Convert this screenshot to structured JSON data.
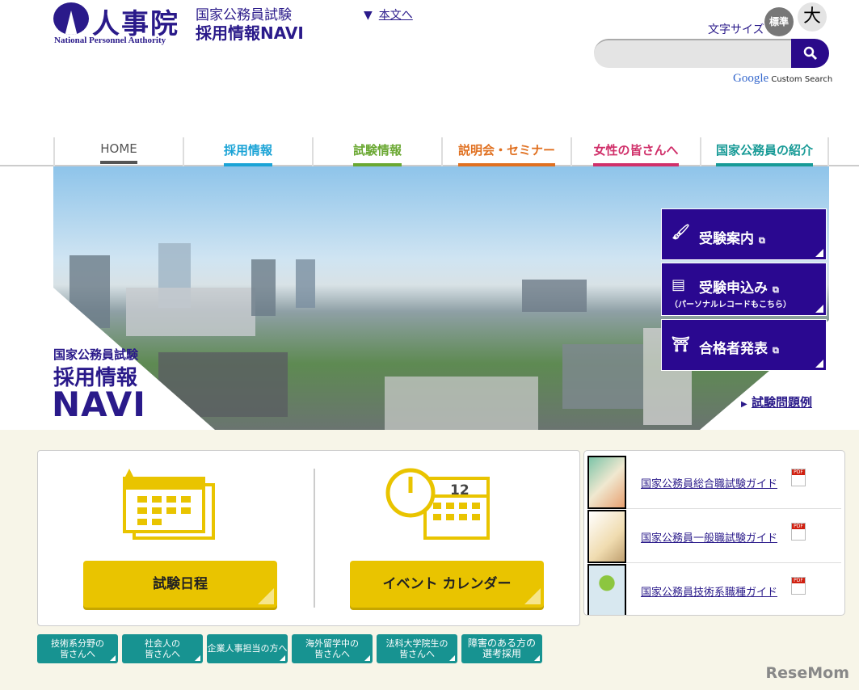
{
  "header": {
    "logo_jp": "人事院",
    "logo_en": "National Personnel Authority",
    "subtitle1": "国家公務員試験",
    "subtitle2": "採用情報NAVI",
    "skip_link": "本文へ",
    "font_size_label": "文字サイズ",
    "font_std": "標準",
    "font_large": "大",
    "search_placeholder": "",
    "google_logo": "Google",
    "custom_search": "Custom Search"
  },
  "nav": [
    {
      "label": "HOME",
      "color": "#555555"
    },
    {
      "label": "採用情報",
      "color": "#1aa3d6"
    },
    {
      "label": "試験情報",
      "color": "#6aa832"
    },
    {
      "label": "説明会・セミナー",
      "color": "#e07020"
    },
    {
      "label": "女性の皆さんへ",
      "color": "#d0306a"
    },
    {
      "label": "国家公務員の紹介",
      "color": "#179a96"
    }
  ],
  "hero": {
    "navi_line1": "国家公務員試験",
    "navi_line2": "採用情報",
    "navi_line3": "NAVI",
    "buttons": [
      {
        "label": "受験案内"
      },
      {
        "label": "受験申込み",
        "sub": "（パーソナルレコードもこちら）"
      },
      {
        "label": "合格者発表"
      }
    ],
    "exam_examples": "試験問題例"
  },
  "calendar": {
    "exam_schedule": "試験日程",
    "event_calendar": "イベント カレンダー",
    "calendar_number": "12"
  },
  "guides": [
    {
      "label": "国家公務員総合職試験ガイド"
    },
    {
      "label": "国家公務員一般職試験ガイド"
    },
    {
      "label": "国家公務員技術系職種ガイド"
    }
  ],
  "pdf_label": "PDF",
  "target_buttons": [
    {
      "line1": "技術系分野の",
      "line2": "皆さんへ"
    },
    {
      "line1": "社会人の",
      "line2": "皆さんへ"
    },
    {
      "line1": "企業人事担当の方へ",
      "line2": ""
    },
    {
      "line1": "海外留学中の",
      "line2": "皆さんへ"
    },
    {
      "line1": "法科大学院生の",
      "line2": "皆さんへ"
    },
    {
      "line1": "障害のある方の",
      "line2": "選考採用"
    }
  ],
  "watermark": "ReseMom"
}
